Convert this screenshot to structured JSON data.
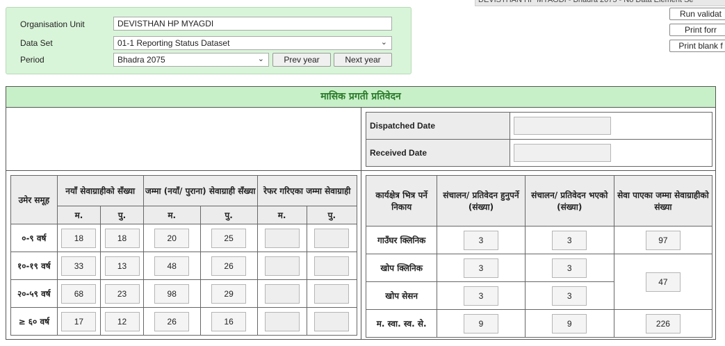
{
  "top_note": "DEVISTHAN HP MYAGDI - Bhadra 2075 - No Data Element Se",
  "right_buttons": {
    "run_validation": "Run validat",
    "print_form": "Print forr",
    "print_blank": "Print blank f"
  },
  "selection": {
    "org_unit_label": "Organisation Unit",
    "org_unit_value": "DEVISTHAN HP MYAGDI",
    "data_set_label": "Data Set",
    "data_set_value": "01-1 Reporting Status Dataset",
    "period_label": "Period",
    "period_value": "Bhadra 2075",
    "prev_year": "Prev year",
    "next_year": "Next year"
  },
  "form_title": "मासिक प्रगती प्रतिवेदन",
  "dates": {
    "dispatched_label": "Dispatched Date",
    "dispatched_value": "",
    "received_label": "Received Date",
    "received_value": ""
  },
  "age_table": {
    "age_group_header": "उमेर समूह",
    "new_header": "नयाँ सेवाग्राहीको सँख्या",
    "total_header": "जम्मा (नयाँ/ पुराना) सेवाग्राही सँख्या",
    "referred_header": "रेफर गरिएका जम्मा सेवाग्राही",
    "female": "म.",
    "male": "पु.",
    "rows": [
      {
        "age": "०-९ वर्ष",
        "new_f": "18",
        "new_m": "18",
        "tot_f": "20",
        "tot_m": "25",
        "ref_f": "",
        "ref_m": ""
      },
      {
        "age": "१०-१९ वर्ष",
        "new_f": "33",
        "new_m": "13",
        "tot_f": "48",
        "tot_m": "26",
        "ref_f": "",
        "ref_m": ""
      },
      {
        "age": "२०-५९ वर्ष",
        "new_f": "68",
        "new_m": "23",
        "tot_f": "98",
        "tot_m": "29",
        "ref_f": "",
        "ref_m": ""
      },
      {
        "age": "≥ ६० वर्ष",
        "new_f": "17",
        "new_m": "12",
        "tot_f": "26",
        "tot_m": "16",
        "ref_f": "",
        "ref_m": ""
      }
    ]
  },
  "outreach_table": {
    "col1": "कार्यक्षेत्र भित्र पर्ने निकाय",
    "col2": "संचालन/ प्रतिवेदन हुनुपर्ने (संख्या)",
    "col3": "संचालन/ प्रतिवेदन भएको (संख्या)",
    "col4": "सेवा पाएका जम्मा सेवाग्राहीको संख्या",
    "rows": [
      {
        "name": "गाउँघर क्लिनिक",
        "should": "3",
        "done": "3"
      },
      {
        "name": "खोप क्लिनिक",
        "should": "3",
        "done": "3"
      },
      {
        "name": "खोप सेसन",
        "should": "3",
        "done": "3"
      },
      {
        "name": "म. स्वा. स्व. से.",
        "should": "9",
        "done": "9"
      }
    ],
    "served": [
      "97",
      "47",
      "226"
    ]
  }
}
